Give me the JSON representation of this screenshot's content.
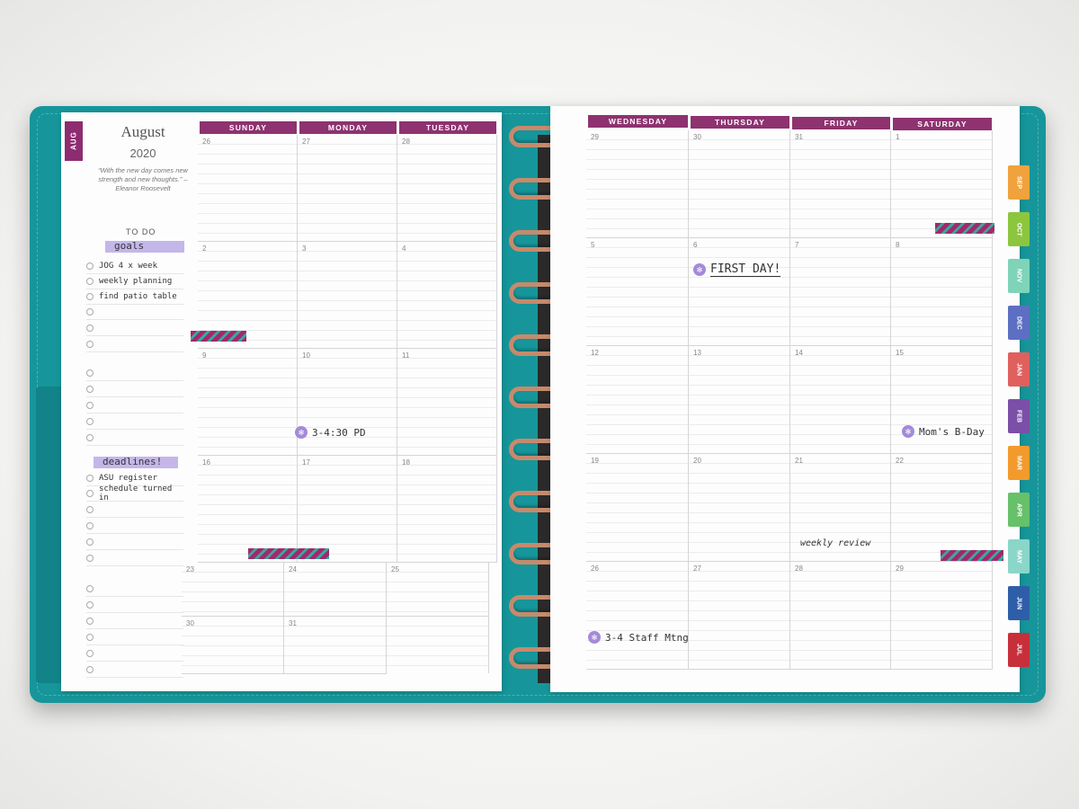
{
  "left_page": {
    "month_tab": "AUG",
    "month": "August",
    "year": "2020",
    "quote": "“With the new day comes new strength and new thoughts.” – Eleanor Roosevelt",
    "todo_heading": "TO DO",
    "goals_label": "goals",
    "goals": [
      "JOG 4 x week",
      "weekly planning",
      "find patio table"
    ],
    "deadlines_label": "deadlines!",
    "deadlines": [
      "ASU register",
      "schedule turned in"
    ],
    "days": [
      "SUNDAY",
      "MONDAY",
      "TUESDAY"
    ],
    "dates": [
      [
        "26",
        "27",
        "28"
      ],
      [
        "2",
        "3",
        "4"
      ],
      [
        "9",
        "10",
        "11"
      ],
      [
        "16",
        "17",
        "18"
      ],
      [
        "23",
        "24",
        "25"
      ],
      [
        "30",
        "31",
        ""
      ]
    ],
    "event_pd": "3-4:30 PD"
  },
  "right_page": {
    "days": [
      "WEDNESDAY",
      "THURSDAY",
      "FRIDAY",
      "SATURDAY"
    ],
    "dates": [
      [
        "29",
        "30",
        "31",
        "1"
      ],
      [
        "5",
        "6",
        "7",
        "8"
      ],
      [
        "12",
        "13",
        "14",
        "15"
      ],
      [
        "19",
        "20",
        "21",
        "22"
      ],
      [
        "26",
        "27",
        "28",
        "29"
      ]
    ],
    "event_first_day": "FIRST DAY!",
    "event_moms_bday": "Mom's B-Day",
    "event_weekly_review": "weekly review",
    "event_staff": "3-4 Staff Mtng"
  },
  "month_tabs": [
    {
      "label": "SEP",
      "color": "#f0a23c"
    },
    {
      "label": "OCT",
      "color": "#8cc63f"
    },
    {
      "label": "NOV",
      "color": "#7fd3b8"
    },
    {
      "label": "DEC",
      "color": "#5d6fc2"
    },
    {
      "label": "JAN",
      "color": "#e0605e"
    },
    {
      "label": "FEB",
      "color": "#7b4fa8"
    },
    {
      "label": "MAR",
      "color": "#f39a2c"
    },
    {
      "label": "APR",
      "color": "#67c06a"
    },
    {
      "label": "MAY",
      "color": "#8ad6c9"
    },
    {
      "label": "JUN",
      "color": "#2f5ea8"
    },
    {
      "label": "JUL",
      "color": "#c7303a"
    }
  ]
}
